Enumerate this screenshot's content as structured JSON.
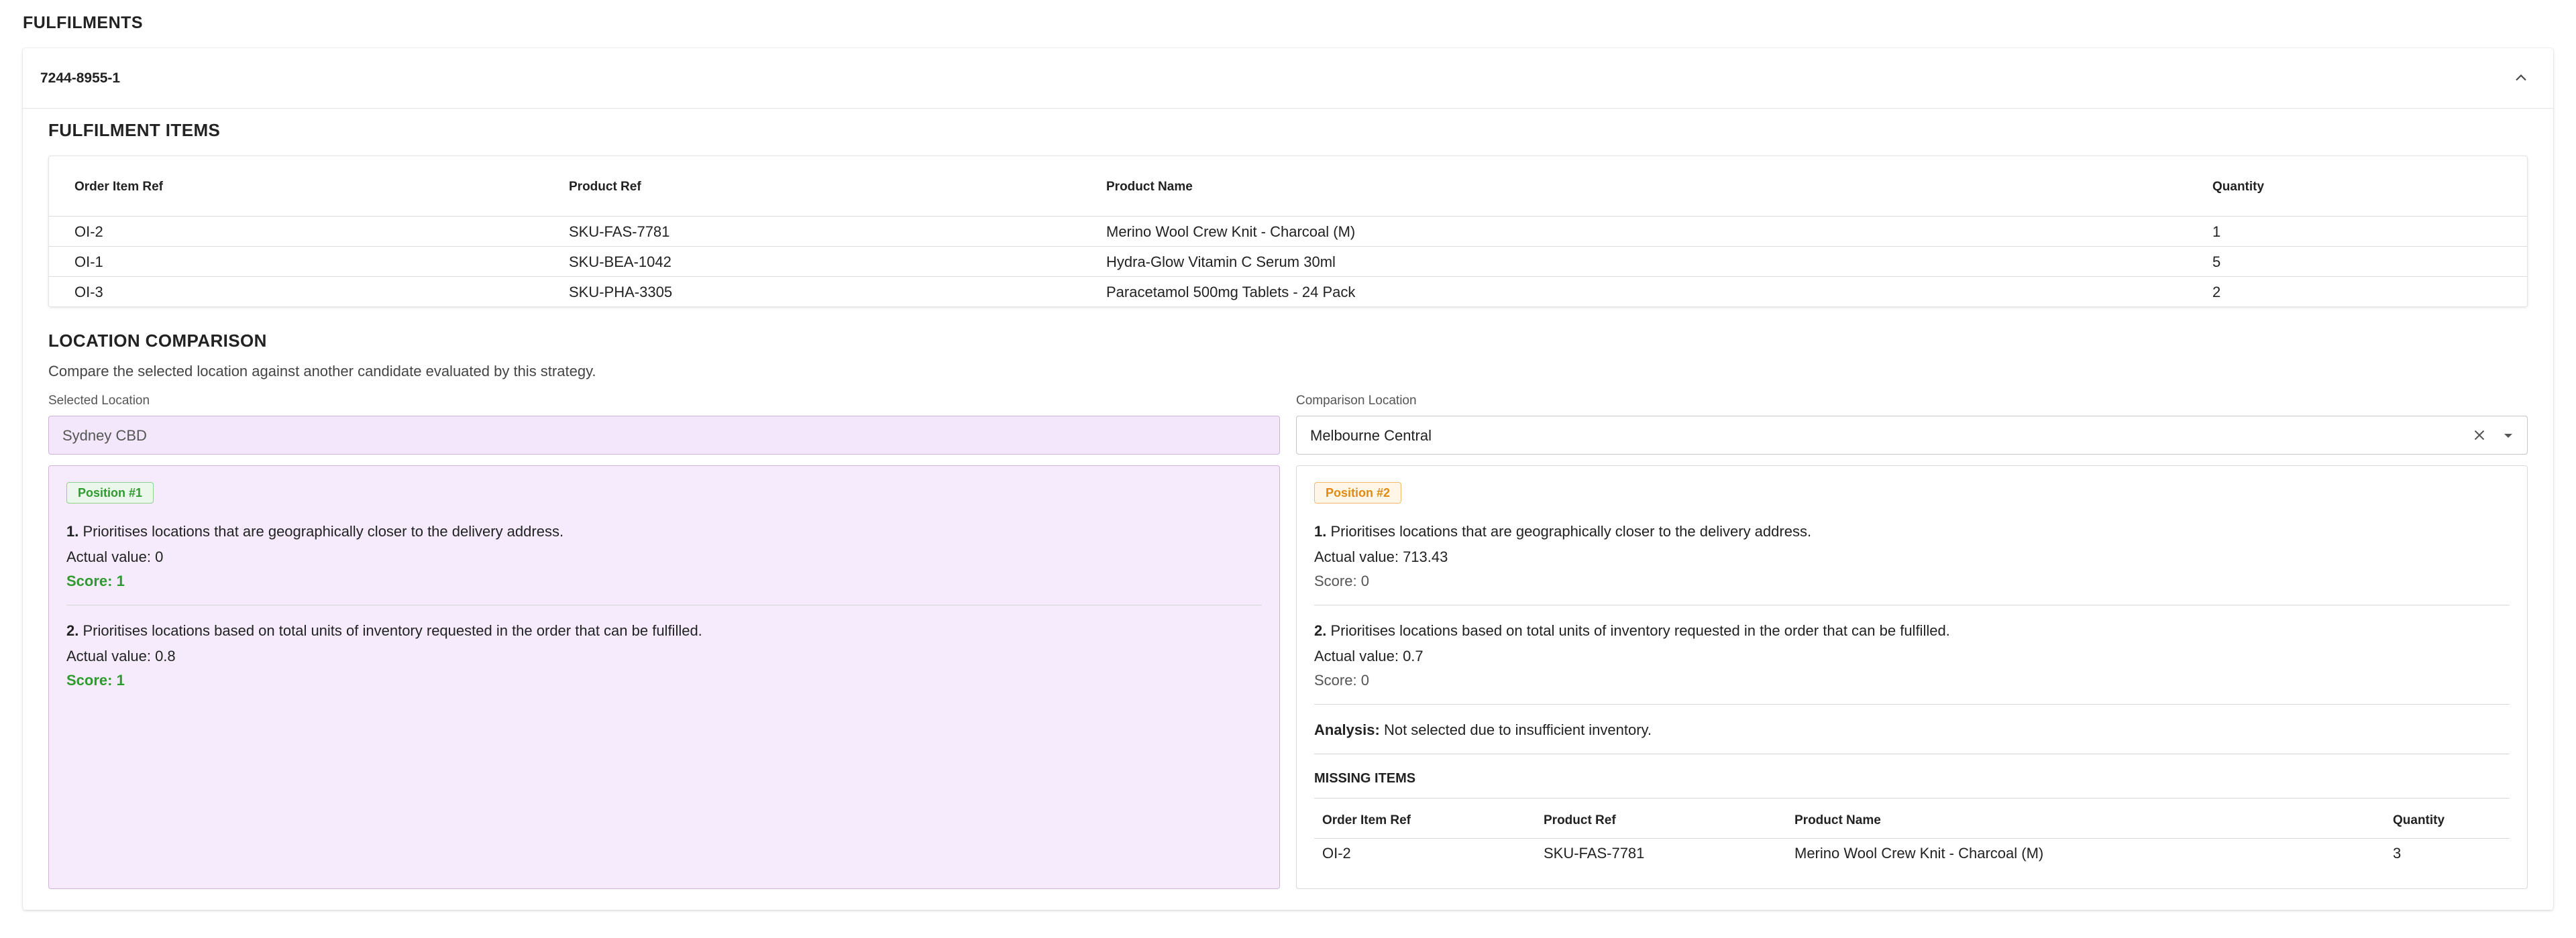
{
  "page_title": "FULFILMENTS",
  "fulfilment": {
    "ref": "7244-8955-1",
    "items_title": "FULFILMENT ITEMS",
    "columns": [
      "Order Item Ref",
      "Product Ref",
      "Product Name",
      "Quantity"
    ],
    "rows": [
      [
        "OI-2",
        "SKU-FAS-7781",
        "Merino Wool Crew Knit - Charcoal (M)",
        "1"
      ],
      [
        "OI-1",
        "SKU-BEA-1042",
        "Hydra-Glow Vitamin C Serum 30ml",
        "5"
      ],
      [
        "OI-3",
        "SKU-PHA-3305",
        "Paracetamol 500mg Tablets - 24 Pack",
        "2"
      ]
    ]
  },
  "comparison": {
    "title": "LOCATION COMPARISON",
    "subtitle": "Compare the selected location against another candidate evaluated by this strategy.",
    "selected_label": "Selected Location",
    "selected_value": "Sydney CBD",
    "comparison_label": "Comparison Location",
    "comparison_value": "Melbourne Central",
    "selected_panel": {
      "badge": "Position #1",
      "criteria": [
        {
          "num": "1.",
          "text": "Prioritises locations that are geographically closer to the delivery address.",
          "actual": "Actual value: 0",
          "score": "Score: 1"
        },
        {
          "num": "2.",
          "text": "Prioritises locations based on total units of inventory requested in the order that can be fulfilled.",
          "actual": "Actual value: 0.8",
          "score": "Score: 1"
        }
      ]
    },
    "comparison_panel": {
      "badge": "Position #2",
      "criteria": [
        {
          "num": "1.",
          "text": "Prioritises locations that are geographically closer to the delivery address.",
          "actual": "Actual value: 713.43",
          "score": "Score: 0"
        },
        {
          "num": "2.",
          "text": "Prioritises locations based on total units of inventory requested in the order that can be fulfilled.",
          "actual": "Actual value: 0.7",
          "score": "Score: 0"
        }
      ],
      "analysis_label": "Analysis:",
      "analysis_text": "Not selected due to insufficient inventory.",
      "missing_title": "MISSING ITEMS",
      "missing_columns": [
        "Order Item Ref",
        "Product Ref",
        "Product Name",
        "Quantity"
      ],
      "missing_rows": [
        [
          "OI-2",
          "SKU-FAS-7781",
          "Merino Wool Crew Knit - Charcoal (M)",
          "3"
        ]
      ]
    }
  },
  "icons": {
    "collapse": "chevron-up-icon",
    "clear": "close-icon",
    "dropdown": "chevron-down-icon"
  },
  "colors": {
    "selected_bg": "#f6ebfd",
    "score_green": "#2e9b2e",
    "badge_orange": "#e08a12"
  }
}
